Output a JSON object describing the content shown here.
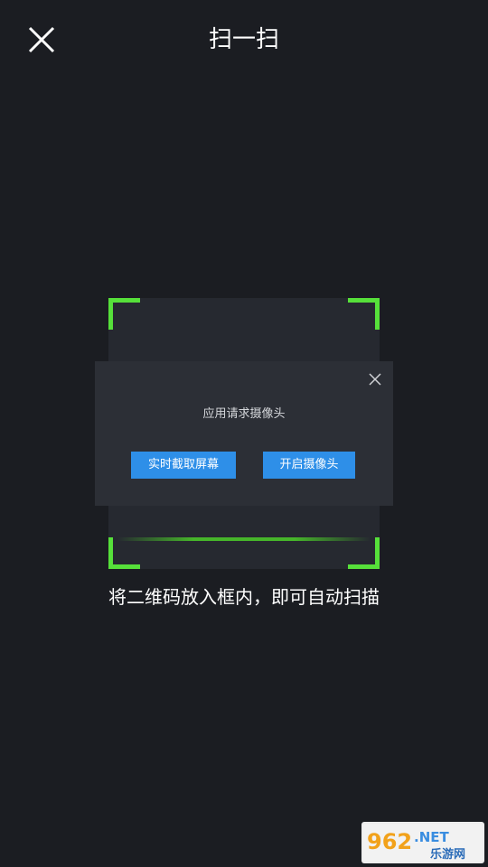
{
  "header": {
    "title": "扫一扫",
    "close_icon": "close-icon"
  },
  "scanner": {
    "frame_color": "#56e03a",
    "hint": "将二维码放入框内，即可自动扫描"
  },
  "dialog": {
    "message": "应用请求摄像头",
    "screen_capture_label": "实时截取屏幕",
    "open_camera_label": "开启摄像头",
    "button_color": "#2e8fe8"
  },
  "watermark": {
    "brand_number": "962",
    "brand_suffix": ".NET",
    "site_name": "乐游网"
  }
}
